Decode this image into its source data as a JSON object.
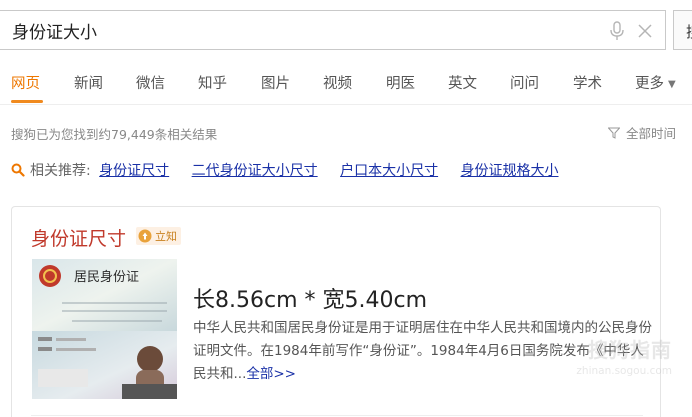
{
  "search": {
    "query": "身份证大小",
    "button_label": "搜"
  },
  "tabs": [
    {
      "label": "网页",
      "active": true
    },
    {
      "label": "新闻"
    },
    {
      "label": "微信"
    },
    {
      "label": "知乎"
    },
    {
      "label": "图片"
    },
    {
      "label": "视频"
    },
    {
      "label": "明医"
    },
    {
      "label": "英文"
    },
    {
      "label": "问问"
    },
    {
      "label": "学术"
    },
    {
      "label": "更多"
    }
  ],
  "results": {
    "count_text": "搜狗已为您找到约79,449条相关结果",
    "filter_label": "全部时间"
  },
  "related": {
    "label": "相关推荐:",
    "links": [
      "身份证尺寸",
      "二代身份证大小尺寸",
      "户口本大小尺寸",
      "身份证规格大小"
    ]
  },
  "card": {
    "title": "身份证尺寸",
    "badge": "立知",
    "headline": "长8.56cm * 宽5.40cm",
    "description": "中华人民共和国居民身份证是用于证明居住在中华人民共和国境内的公民身份证明文件。在1984年前写作“身份证”。1984年4月6日国务院发布《中华人民共和...",
    "more_link": "全部>>",
    "image_labels": {
      "title_text": "居民身份证"
    }
  },
  "watermark": {
    "logo": "搜狗指南",
    "url": "zhinan.sogou.com"
  },
  "colors": {
    "accent": "#ee7700",
    "link": "#1a31a7",
    "title_red": "#c0392b"
  }
}
